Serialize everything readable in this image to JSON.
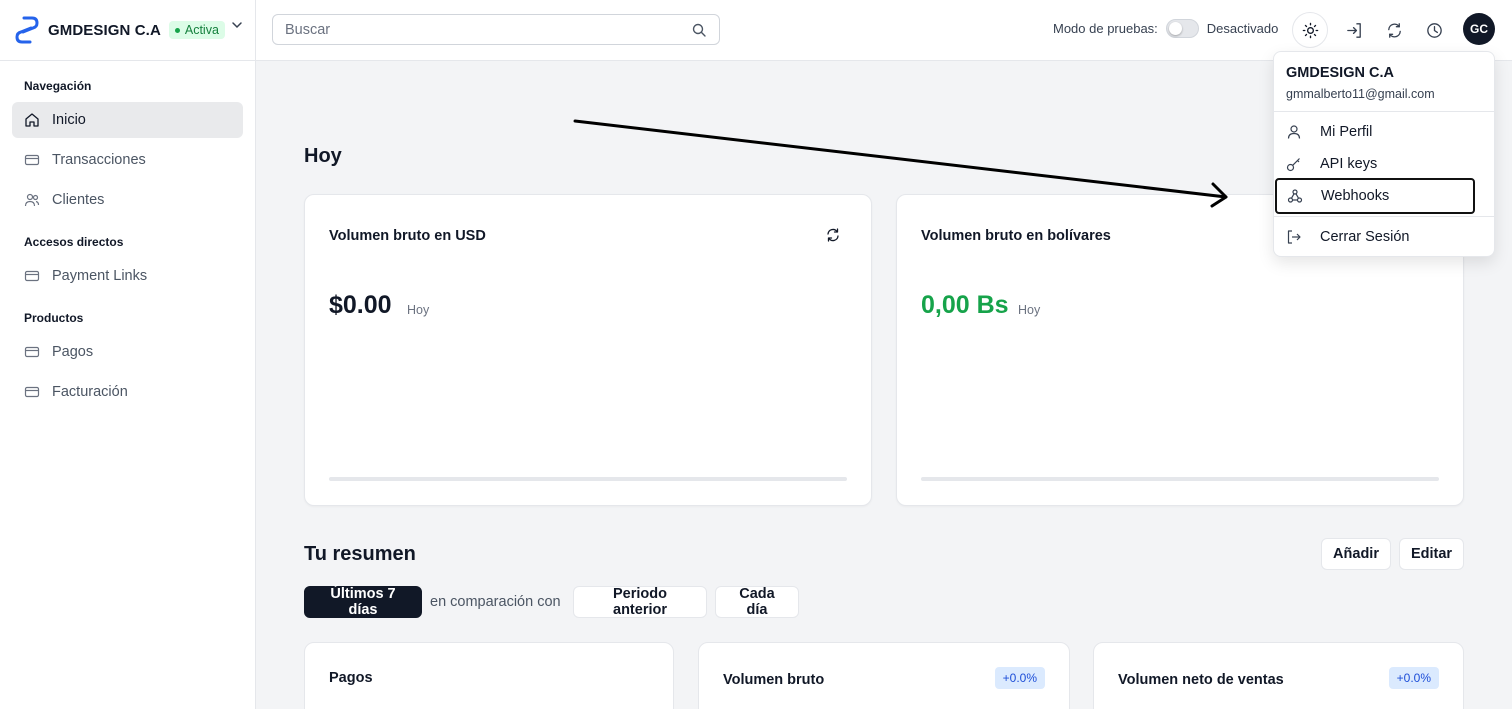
{
  "sidebar": {
    "brand_name": "GMDESIGN C.A",
    "status_badge": "Activa",
    "sections": {
      "navigation": "Navegación",
      "shortcuts": "Accesos directos",
      "products": "Productos"
    },
    "items": {
      "inicio": "Inicio",
      "transacciones": "Transacciones",
      "clientes": "Clientes",
      "payment_links": "Payment Links",
      "pagos": "Pagos",
      "facturacion": "Facturación"
    }
  },
  "header": {
    "search_placeholder": "Buscar",
    "test_mode_label": "Modo de pruebas:",
    "test_mode_state": "Desactivado",
    "avatar_initials": "GC"
  },
  "main": {
    "today_heading": "Hoy",
    "usd_card": {
      "title": "Volumen bruto en USD",
      "amount": "$0.00",
      "period": "Hoy"
    },
    "bs_card": {
      "title": "Volumen bruto en bolívares",
      "amount": "0,00 Bs",
      "period": "Hoy",
      "amount_color": "#16a34a"
    },
    "summary_heading": "Tu resumen",
    "add_button": "Añadir",
    "edit_button": "Editar",
    "range_button": "Últimos 7 días",
    "compare_text": "en comparación con",
    "previous_period_button": "Periodo anterior",
    "daily_button": "Cada día",
    "stats": [
      {
        "title": "Pagos"
      },
      {
        "title": "Volumen bruto",
        "change": "+0.0%"
      },
      {
        "title": "Volumen neto de ventas",
        "change": "+0.0%"
      }
    ]
  },
  "user_menu": {
    "name": "GMDESIGN C.A",
    "email": "gmmalberto11@gmail.com",
    "items": {
      "profile": "Mi Perfil",
      "api_keys": "API keys",
      "webhooks": "Webhooks",
      "logout": "Cerrar Sesión"
    }
  },
  "icons": {
    "logo": "chain-link-logo-icon",
    "accent": "#2563eb",
    "active_badge_color": "#16a34a"
  }
}
